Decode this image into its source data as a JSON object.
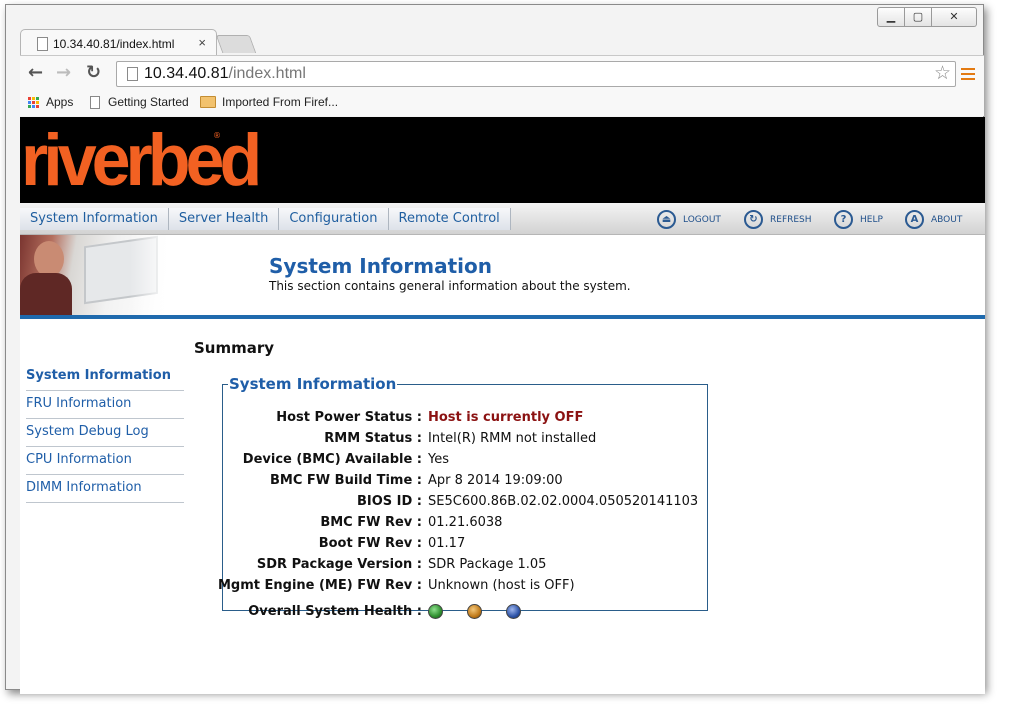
{
  "browser": {
    "tab_title": "10.34.40.81/index.html",
    "tab_close": "×",
    "address_host": "10.34.40.81",
    "address_path": "/index.html",
    "bookmarks": [
      "Apps",
      "Getting Started",
      "Imported From Firef..."
    ],
    "win_controls": {
      "minimize": "▁",
      "maximize": "▢",
      "close": "✕"
    }
  },
  "brand": {
    "logo_text": "riverbed",
    "logo_color": "#f26122"
  },
  "main_nav": [
    "System Information",
    "Server Health",
    "Configuration",
    "Remote Control"
  ],
  "utility_nav": [
    {
      "label": "LOGOUT",
      "icon": "logout-icon",
      "glyph": "⏏"
    },
    {
      "label": "REFRESH",
      "icon": "refresh-icon",
      "glyph": "↻"
    },
    {
      "label": "HELP",
      "icon": "help-icon",
      "glyph": "?"
    },
    {
      "label": "ABOUT",
      "icon": "about-icon",
      "glyph": "A"
    }
  ],
  "page_header": {
    "title": "System Information",
    "subtitle": "This section contains general information about the system."
  },
  "section_title": "Summary",
  "sidebar": [
    {
      "label": "System Information",
      "active": true
    },
    {
      "label": "FRU Information",
      "active": false
    },
    {
      "label": "System Debug Log",
      "active": false
    },
    {
      "label": "CPU Information",
      "active": false
    },
    {
      "label": "DIMM Information",
      "active": false
    }
  ],
  "system_info": {
    "legend": "System Information",
    "rows": [
      {
        "label": "Host Power Status :",
        "value": "Host is currently OFF",
        "alert": true
      },
      {
        "label": "RMM Status :",
        "value": "Intel(R) RMM not installed"
      },
      {
        "label": "Device (BMC) Available :",
        "value": "Yes"
      },
      {
        "label": "BMC FW Build Time :",
        "value": "Apr 8 2014 19:09:00"
      },
      {
        "label": "BIOS ID :",
        "value": "SE5C600.86B.02.02.0004.050520141103"
      },
      {
        "label": "BMC FW Rev :",
        "value": "01.21.6038"
      },
      {
        "label": "Boot FW Rev :",
        "value": "01.17"
      },
      {
        "label": "SDR Package Version :",
        "value": "SDR Package 1.05"
      },
      {
        "label": "Mgmt Engine (ME) FW Rev :",
        "value": "Unknown (host is OFF)"
      }
    ],
    "health_label": "Overall System Health :",
    "health_lights": [
      {
        "name": "green",
        "color": "#2f8f2f"
      },
      {
        "name": "amber",
        "color": "#c07a1a"
      },
      {
        "name": "blue",
        "color": "#2e54a8"
      }
    ]
  },
  "colors": {
    "accent_blue": "#1f5ea8",
    "alert_red": "#8b1212"
  }
}
